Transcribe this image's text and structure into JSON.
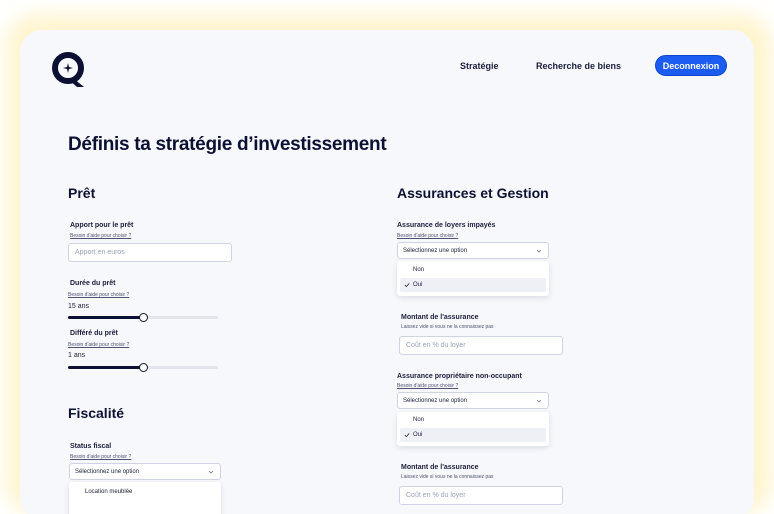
{
  "header": {
    "nav": {
      "strategy": "Stratégie",
      "search": "Recherche de biens"
    },
    "logout_label": "Deconnexion"
  },
  "page_title": "Définis ta stratégie d’investissement",
  "help_text": "Besoin d'aide pour choisir ?",
  "loan": {
    "title": "Prêt",
    "contribution": {
      "label": "Apport pour le prêt",
      "placeholder": "Apport en euros"
    },
    "duration": {
      "label": "Durée du prêt",
      "value_text": "15 ans",
      "fraction": 0.5
    },
    "deferral": {
      "label": "Différé du prêt",
      "value_text": "1 ans",
      "fraction": 0.5
    }
  },
  "tax": {
    "title": "Fiscalité",
    "status": {
      "label": "Status fiscal",
      "placeholder": "Sélectionnez une option",
      "options": [
        "Location meublée"
      ]
    }
  },
  "insurance": {
    "title": "Assurances et Gestion",
    "unpaid_rent": {
      "label": "Assurance de loyers impayés",
      "placeholder": "Sélectionnez une option",
      "options": [
        "Non",
        "Oui"
      ],
      "selected": "Oui"
    },
    "amount_1": {
      "label": "Montant de l'assurance",
      "hint": "Laissez vide si vous ne la connaissez pas",
      "placeholder": "Coût en % du loyer"
    },
    "non_occupant": {
      "label": "Assurance propriétaire non-occupant",
      "placeholder": "Sélectionnez une option",
      "options": [
        "Non",
        "Oui"
      ],
      "selected": "Oui"
    },
    "amount_2": {
      "label": "Montant de l'assurance",
      "hint": "Laissez vide si vous ne la connaissez pas",
      "placeholder": "Coût en % du loyer"
    }
  },
  "colors": {
    "accent": "#1d5cf0",
    "text": "#0c1032",
    "background": "#f7f8fc",
    "glow": "#fff3c8"
  }
}
